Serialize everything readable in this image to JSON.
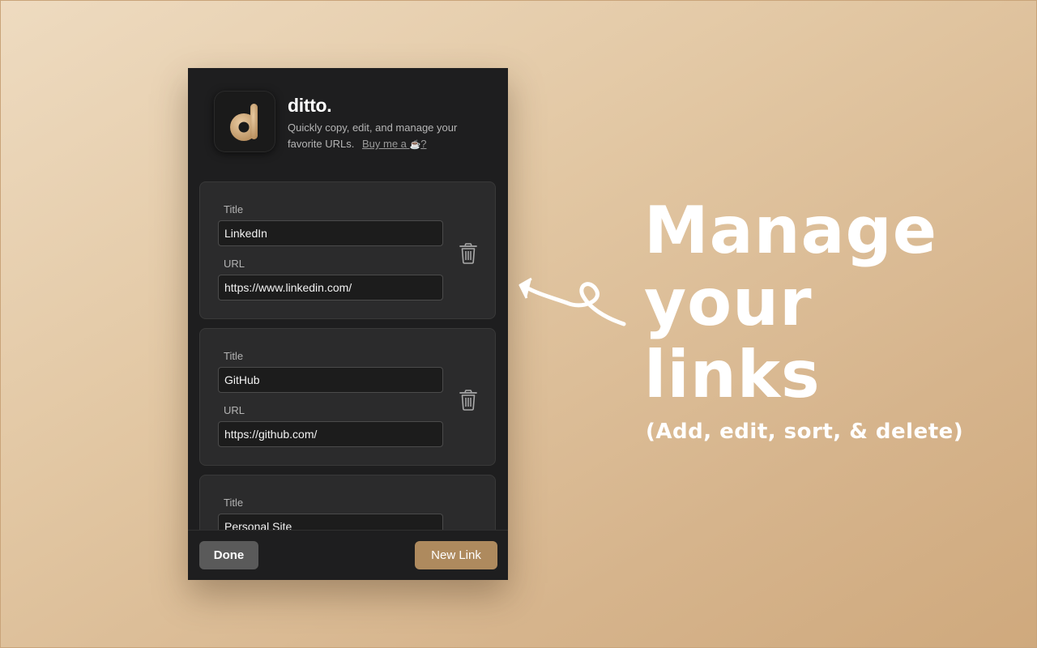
{
  "app": {
    "name": "ditto.",
    "tagline": "Quickly copy, edit, and manage your favorite URLs.",
    "coffee_link_prefix": "Buy me a ",
    "coffee_link_suffix": "?",
    "coffee_icon": "☕",
    "logo_letter": "d"
  },
  "links": [
    {
      "title_label": "Title",
      "title_value": "LinkedIn",
      "url_label": "URL",
      "url_value": "https://www.linkedin.com/"
    },
    {
      "title_label": "Title",
      "title_value": "GitHub",
      "url_label": "URL",
      "url_value": "https://github.com/"
    },
    {
      "title_label": "Title",
      "title_value": "Personal Site"
    }
  ],
  "footer": {
    "done_label": "Done",
    "new_link_label": "New Link"
  },
  "annotation": {
    "line1": "Manage",
    "line2": "your",
    "line3": "links",
    "subtitle": "(Add, edit, sort, & delete)"
  },
  "colors": {
    "accent": "#ae8a5e",
    "panel_bg": "#1e1e1f",
    "card_bg": "#2b2b2c",
    "page_bg": "#dcbd98"
  }
}
